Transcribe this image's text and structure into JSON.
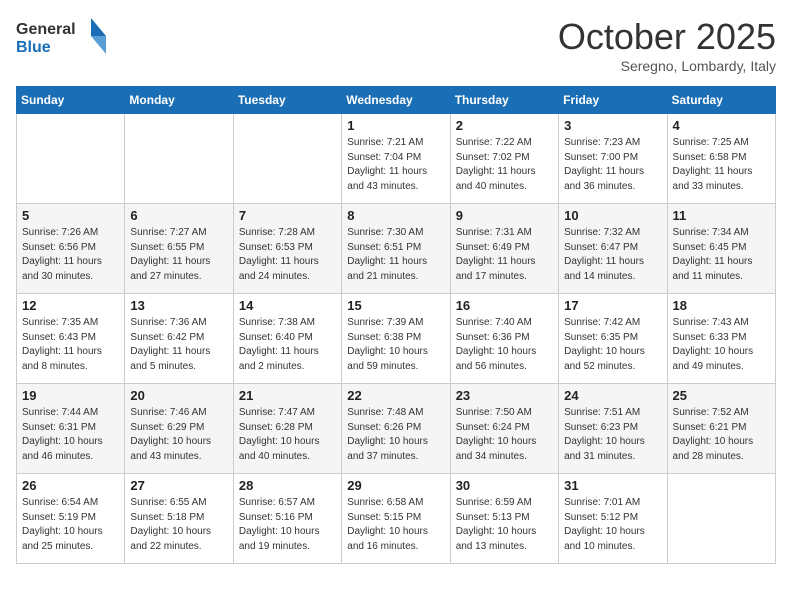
{
  "logo": {
    "general": "General",
    "blue": "Blue"
  },
  "title": "October 2025",
  "subtitle": "Seregno, Lombardy, Italy",
  "days_of_week": [
    "Sunday",
    "Monday",
    "Tuesday",
    "Wednesday",
    "Thursday",
    "Friday",
    "Saturday"
  ],
  "weeks": [
    [
      {
        "day": "",
        "info": ""
      },
      {
        "day": "",
        "info": ""
      },
      {
        "day": "",
        "info": ""
      },
      {
        "day": "1",
        "info": "Sunrise: 7:21 AM\nSunset: 7:04 PM\nDaylight: 11 hours\nand 43 minutes."
      },
      {
        "day": "2",
        "info": "Sunrise: 7:22 AM\nSunset: 7:02 PM\nDaylight: 11 hours\nand 40 minutes."
      },
      {
        "day": "3",
        "info": "Sunrise: 7:23 AM\nSunset: 7:00 PM\nDaylight: 11 hours\nand 36 minutes."
      },
      {
        "day": "4",
        "info": "Sunrise: 7:25 AM\nSunset: 6:58 PM\nDaylight: 11 hours\nand 33 minutes."
      }
    ],
    [
      {
        "day": "5",
        "info": "Sunrise: 7:26 AM\nSunset: 6:56 PM\nDaylight: 11 hours\nand 30 minutes."
      },
      {
        "day": "6",
        "info": "Sunrise: 7:27 AM\nSunset: 6:55 PM\nDaylight: 11 hours\nand 27 minutes."
      },
      {
        "day": "7",
        "info": "Sunrise: 7:28 AM\nSunset: 6:53 PM\nDaylight: 11 hours\nand 24 minutes."
      },
      {
        "day": "8",
        "info": "Sunrise: 7:30 AM\nSunset: 6:51 PM\nDaylight: 11 hours\nand 21 minutes."
      },
      {
        "day": "9",
        "info": "Sunrise: 7:31 AM\nSunset: 6:49 PM\nDaylight: 11 hours\nand 17 minutes."
      },
      {
        "day": "10",
        "info": "Sunrise: 7:32 AM\nSunset: 6:47 PM\nDaylight: 11 hours\nand 14 minutes."
      },
      {
        "day": "11",
        "info": "Sunrise: 7:34 AM\nSunset: 6:45 PM\nDaylight: 11 hours\nand 11 minutes."
      }
    ],
    [
      {
        "day": "12",
        "info": "Sunrise: 7:35 AM\nSunset: 6:43 PM\nDaylight: 11 hours\nand 8 minutes."
      },
      {
        "day": "13",
        "info": "Sunrise: 7:36 AM\nSunset: 6:42 PM\nDaylight: 11 hours\nand 5 minutes."
      },
      {
        "day": "14",
        "info": "Sunrise: 7:38 AM\nSunset: 6:40 PM\nDaylight: 11 hours\nand 2 minutes."
      },
      {
        "day": "15",
        "info": "Sunrise: 7:39 AM\nSunset: 6:38 PM\nDaylight: 10 hours\nand 59 minutes."
      },
      {
        "day": "16",
        "info": "Sunrise: 7:40 AM\nSunset: 6:36 PM\nDaylight: 10 hours\nand 56 minutes."
      },
      {
        "day": "17",
        "info": "Sunrise: 7:42 AM\nSunset: 6:35 PM\nDaylight: 10 hours\nand 52 minutes."
      },
      {
        "day": "18",
        "info": "Sunrise: 7:43 AM\nSunset: 6:33 PM\nDaylight: 10 hours\nand 49 minutes."
      }
    ],
    [
      {
        "day": "19",
        "info": "Sunrise: 7:44 AM\nSunset: 6:31 PM\nDaylight: 10 hours\nand 46 minutes."
      },
      {
        "day": "20",
        "info": "Sunrise: 7:46 AM\nSunset: 6:29 PM\nDaylight: 10 hours\nand 43 minutes."
      },
      {
        "day": "21",
        "info": "Sunrise: 7:47 AM\nSunset: 6:28 PM\nDaylight: 10 hours\nand 40 minutes."
      },
      {
        "day": "22",
        "info": "Sunrise: 7:48 AM\nSunset: 6:26 PM\nDaylight: 10 hours\nand 37 minutes."
      },
      {
        "day": "23",
        "info": "Sunrise: 7:50 AM\nSunset: 6:24 PM\nDaylight: 10 hours\nand 34 minutes."
      },
      {
        "day": "24",
        "info": "Sunrise: 7:51 AM\nSunset: 6:23 PM\nDaylight: 10 hours\nand 31 minutes."
      },
      {
        "day": "25",
        "info": "Sunrise: 7:52 AM\nSunset: 6:21 PM\nDaylight: 10 hours\nand 28 minutes."
      }
    ],
    [
      {
        "day": "26",
        "info": "Sunrise: 6:54 AM\nSunset: 5:19 PM\nDaylight: 10 hours\nand 25 minutes."
      },
      {
        "day": "27",
        "info": "Sunrise: 6:55 AM\nSunset: 5:18 PM\nDaylight: 10 hours\nand 22 minutes."
      },
      {
        "day": "28",
        "info": "Sunrise: 6:57 AM\nSunset: 5:16 PM\nDaylight: 10 hours\nand 19 minutes."
      },
      {
        "day": "29",
        "info": "Sunrise: 6:58 AM\nSunset: 5:15 PM\nDaylight: 10 hours\nand 16 minutes."
      },
      {
        "day": "30",
        "info": "Sunrise: 6:59 AM\nSunset: 5:13 PM\nDaylight: 10 hours\nand 13 minutes."
      },
      {
        "day": "31",
        "info": "Sunrise: 7:01 AM\nSunset: 5:12 PM\nDaylight: 10 hours\nand 10 minutes."
      },
      {
        "day": "",
        "info": ""
      }
    ]
  ]
}
